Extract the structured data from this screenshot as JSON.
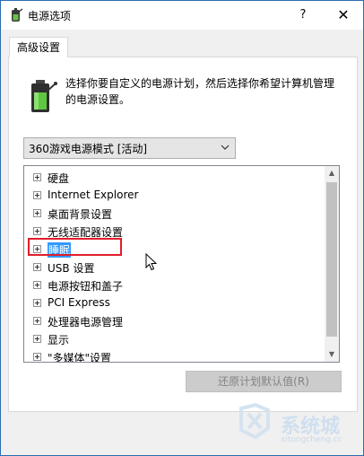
{
  "window": {
    "title": "电源选项",
    "help_label": "?",
    "close_label": "✕"
  },
  "tab": {
    "label": "高级设置"
  },
  "description": "选择你要自定义的电源计划，然后选择你希望计算机管理的电源设置。",
  "plan_select": {
    "value": "360游戏电源模式 [活动]"
  },
  "tree_items": [
    {
      "label": "硬盘"
    },
    {
      "label": "Internet Explorer"
    },
    {
      "label": "桌面背景设置"
    },
    {
      "label": "无线适配器设置"
    },
    {
      "label": "睡眠"
    },
    {
      "label": "USB 设置"
    },
    {
      "label": "电源按钮和盖子"
    },
    {
      "label": "PCI Express"
    },
    {
      "label": "处理器电源管理"
    },
    {
      "label": "显示"
    },
    {
      "label": "\"多媒体\"设置"
    }
  ],
  "restore_button": {
    "label": "还原计划默认值(R)"
  },
  "scrollbar": {
    "up": "▲",
    "down": "▼"
  },
  "watermark": {
    "text": "系统城",
    "url": "xitongcheng.cc"
  },
  "colors": {
    "selection": "#3399ff",
    "highlight_border": "#e11d2b",
    "window_border": "#2b6cb0"
  },
  "icons": {
    "title": "power-options-icon",
    "battery": "battery-plan-icon",
    "cursor": "mouse-cursor-icon"
  }
}
